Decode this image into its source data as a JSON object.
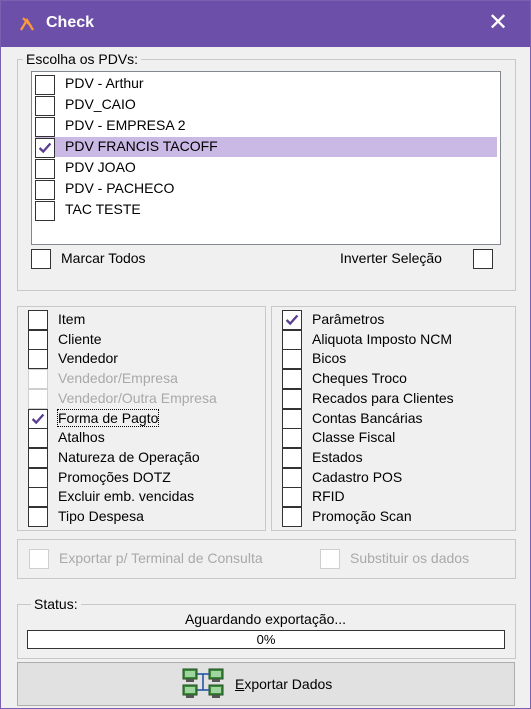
{
  "window": {
    "title": "Check"
  },
  "pdv_group": {
    "legend": "Escolha os PDVs:",
    "items": [
      {
        "label": "PDV - Arthur",
        "checked": false,
        "selected": false
      },
      {
        "label": "PDV_CAIO",
        "checked": false,
        "selected": false
      },
      {
        "label": "PDV - EMPRESA 2",
        "checked": false,
        "selected": false
      },
      {
        "label": "PDV FRANCIS TACOFF",
        "checked": true,
        "selected": true
      },
      {
        "label": "PDV JOAO",
        "checked": false,
        "selected": false
      },
      {
        "label": "PDV - PACHECO",
        "checked": false,
        "selected": false
      },
      {
        "label": "TAC TESTE",
        "checked": false,
        "selected": false
      }
    ],
    "mark_all": "Marcar Todos",
    "invert": "Inverter Seleção"
  },
  "left_options": [
    {
      "label": "Item",
      "checked": false,
      "disabled": false
    },
    {
      "label": "Cliente",
      "checked": false,
      "disabled": false
    },
    {
      "label": "Vendedor",
      "checked": false,
      "disabled": false
    },
    {
      "label": "Vendedor/Empresa",
      "checked": false,
      "disabled": true
    },
    {
      "label": "Vendedor/Outra Empresa",
      "checked": false,
      "disabled": true
    },
    {
      "label": "Forma de Pagto",
      "checked": true,
      "disabled": false
    },
    {
      "label": "Atalhos",
      "checked": false,
      "disabled": false
    },
    {
      "label": "Natureza de Operação",
      "checked": false,
      "disabled": false
    },
    {
      "label": "Promoções DOTZ",
      "checked": false,
      "disabled": false
    },
    {
      "label": "Excluir emb. vencidas",
      "checked": false,
      "disabled": false
    },
    {
      "label": "Tipo Despesa",
      "checked": false,
      "disabled": false
    }
  ],
  "right_options": [
    {
      "label": "Parâmetros",
      "checked": true
    },
    {
      "label": "Aliquota Imposto NCM",
      "checked": false
    },
    {
      "label": "Bicos",
      "checked": false
    },
    {
      "label": "Cheques Troco",
      "checked": false
    },
    {
      "label": "Recados para Clientes",
      "checked": false
    },
    {
      "label": "Contas Bancárias",
      "checked": false
    },
    {
      "label": "Classe Fiscal",
      "checked": false
    },
    {
      "label": "Estados",
      "checked": false
    },
    {
      "label": "Cadastro POS",
      "checked": false
    },
    {
      "label": "RFID",
      "checked": false
    },
    {
      "label": "Promoção Scan",
      "checked": false
    }
  ],
  "export_options": {
    "terminal": "Exportar p/ Terminal de Consulta",
    "replace": "Substituir os dados"
  },
  "status": {
    "legend": "Status:",
    "message": "Aguardando exportação...",
    "progress_text": "0%",
    "progress": 0
  },
  "export_button": {
    "label": "Exportar Dados"
  },
  "colors": {
    "titlebar": "#6c4fa8",
    "selection": "#c9b9e4",
    "check": "#5a3e8f"
  }
}
